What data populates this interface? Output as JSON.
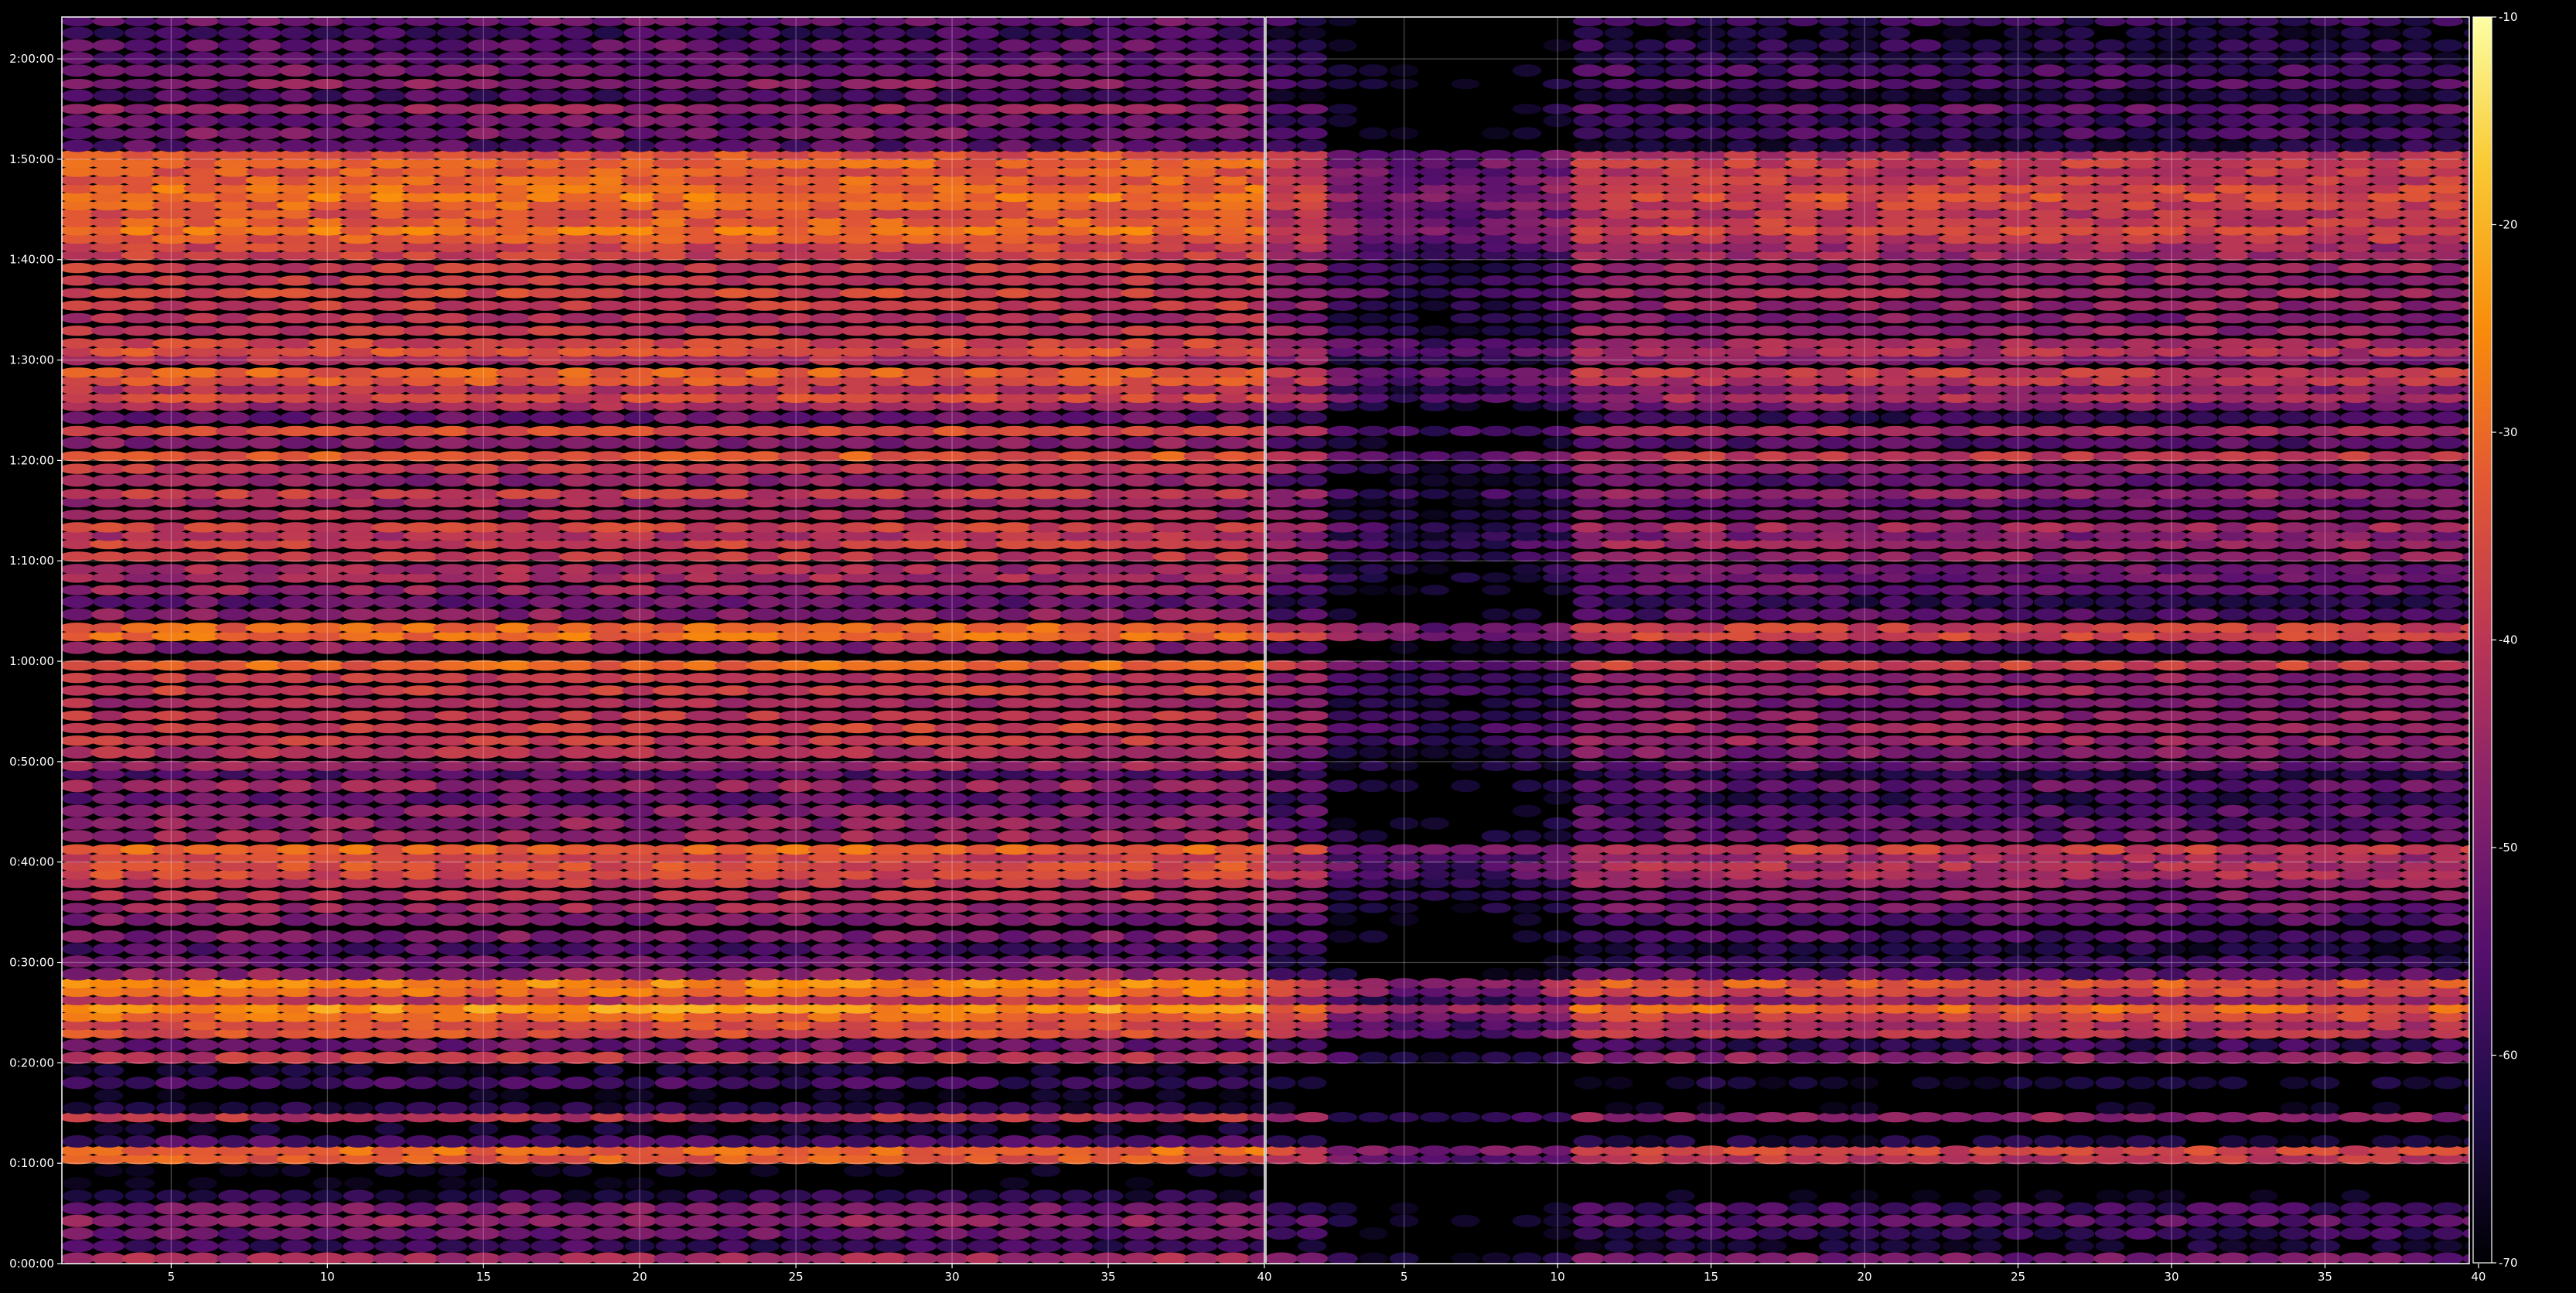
{
  "chart_data": {
    "type": "heatmap",
    "colormap": "inferno",
    "background_color": "#000000",
    "axis_color": "#ffffff",
    "grid": true,
    "panels": [
      {
        "name": "left",
        "xlim": [
          1.5,
          40
        ],
        "ylim": [
          0,
          7450
        ],
        "x_ticks": [
          5,
          10,
          15,
          20,
          25,
          30,
          35,
          40
        ],
        "x_tick_labels": [
          "5",
          "10",
          "15",
          "20",
          "25",
          "30",
          "35",
          "40"
        ],
        "y_ticks": [
          0,
          600,
          1200,
          1800,
          2400,
          3000,
          3600,
          4200,
          4800,
          5400,
          6000,
          6600,
          7200
        ],
        "y_tick_labels": [
          "0:00:00",
          "0:10:00",
          "0:20:00",
          "0:30:00",
          "0:40:00",
          "0:50:00",
          "1:00:00",
          "1:10:00",
          "1:20:00",
          "1:30:00",
          "1:40:00",
          "1:50:00",
          "2:00:00"
        ]
      },
      {
        "name": "right",
        "xlim": [
          0.5,
          39.7
        ],
        "ylim": [
          0,
          7450
        ],
        "x_ticks": [
          5,
          10,
          15,
          20,
          25,
          30,
          35,
          40
        ],
        "x_tick_labels": [
          "5",
          "10",
          "15",
          "20",
          "25",
          "30",
          "35",
          "40"
        ]
      }
    ],
    "colorbar": {
      "range": [
        -70,
        -10
      ],
      "ticks": [
        -70,
        -60,
        -50,
        -40,
        -30,
        -20,
        -10
      ],
      "tick_labels": [
        "-70",
        "-60",
        "-50",
        "-40",
        "-30",
        "-20",
        "-10"
      ]
    },
    "row_levels": [
      [
        0,
        60,
        -44
      ],
      [
        75,
        60,
        -58
      ],
      [
        150,
        60,
        -52
      ],
      [
        225,
        60,
        -47
      ],
      [
        300,
        60,
        -50
      ],
      [
        375,
        60,
        -62
      ],
      [
        450,
        60,
        -70
      ],
      [
        525,
        60,
        -68
      ],
      [
        600,
        50,
        -33
      ],
      [
        650,
        50,
        -30
      ],
      [
        700,
        60,
        -57
      ],
      [
        775,
        60,
        -66
      ],
      [
        850,
        50,
        -40
      ],
      [
        900,
        60,
        -62
      ],
      [
        975,
        60,
        -69
      ],
      [
        1050,
        60,
        -58
      ],
      [
        1125,
        60,
        -66
      ],
      [
        1200,
        60,
        -40
      ],
      [
        1275,
        60,
        -52
      ],
      [
        1350,
        50,
        -34
      ],
      [
        1400,
        50,
        -35
      ],
      [
        1450,
        50,
        -30
      ],
      [
        1500,
        50,
        -24
      ],
      [
        1550,
        50,
        -40
      ],
      [
        1600,
        50,
        -29
      ],
      [
        1650,
        50,
        -26
      ],
      [
        1700,
        60,
        -47
      ],
      [
        1775,
        60,
        -52
      ],
      [
        1850,
        60,
        -56
      ],
      [
        1925,
        60,
        -49
      ],
      [
        2025,
        60,
        -49
      ],
      [
        2100,
        50,
        -44
      ],
      [
        2175,
        50,
        -42
      ],
      [
        2250,
        50,
        -40
      ],
      [
        2300,
        50,
        -36
      ],
      [
        2350,
        50,
        -35
      ],
      [
        2400,
        50,
        -37
      ],
      [
        2450,
        50,
        -31
      ],
      [
        2525,
        60,
        -45
      ],
      [
        2600,
        60,
        -47
      ],
      [
        2675,
        60,
        -48
      ],
      [
        2750,
        60,
        -53
      ],
      [
        2825,
        60,
        -46
      ],
      [
        2900,
        50,
        -55
      ],
      [
        2950,
        50,
        -45
      ],
      [
        3025,
        60,
        -42
      ],
      [
        3100,
        50,
        -39
      ],
      [
        3175,
        50,
        -38
      ],
      [
        3250,
        50,
        -40
      ],
      [
        3325,
        50,
        -43
      ],
      [
        3400,
        50,
        -38
      ],
      [
        3475,
        50,
        -40
      ],
      [
        3550,
        50,
        -31
      ],
      [
        3650,
        60,
        -48
      ],
      [
        3725,
        50,
        -30
      ],
      [
        3775,
        50,
        -31
      ],
      [
        3850,
        60,
        -48
      ],
      [
        3925,
        60,
        -53
      ],
      [
        4000,
        50,
        -46
      ],
      [
        4075,
        50,
        -44
      ],
      [
        4125,
        50,
        -44
      ],
      [
        4200,
        50,
        -40
      ],
      [
        4275,
        50,
        -38
      ],
      [
        4325,
        50,
        -42
      ],
      [
        4375,
        50,
        -38
      ],
      [
        4450,
        50,
        -43
      ],
      [
        4525,
        50,
        -45
      ],
      [
        4575,
        50,
        -39
      ],
      [
        4650,
        60,
        -47
      ],
      [
        4725,
        50,
        -40
      ],
      [
        4800,
        50,
        -33
      ],
      [
        4875,
        60,
        -48
      ],
      [
        4950,
        50,
        -36
      ],
      [
        5025,
        60,
        -52
      ],
      [
        5100,
        50,
        -44
      ],
      [
        5150,
        50,
        -36
      ],
      [
        5200,
        50,
        -41
      ],
      [
        5250,
        50,
        -34
      ],
      [
        5300,
        50,
        -32
      ],
      [
        5375,
        60,
        -42
      ],
      [
        5425,
        50,
        -35
      ],
      [
        5475,
        50,
        -37
      ],
      [
        5550,
        50,
        -40
      ],
      [
        5625,
        50,
        -42
      ],
      [
        5700,
        50,
        -39
      ],
      [
        5775,
        50,
        -37
      ],
      [
        5850,
        50,
        -40
      ],
      [
        5925,
        50,
        -39
      ],
      [
        6000,
        50,
        -38
      ],
      [
        6050,
        50,
        -37
      ],
      [
        6100,
        50,
        -33
      ],
      [
        6150,
        50,
        -29
      ],
      [
        6200,
        50,
        -32
      ],
      [
        6250,
        50,
        -34
      ],
      [
        6300,
        50,
        -31
      ],
      [
        6350,
        50,
        -28
      ],
      [
        6400,
        50,
        -30
      ],
      [
        6450,
        50,
        -32
      ],
      [
        6500,
        50,
        -33
      ],
      [
        6550,
        50,
        -31
      ],
      [
        6600,
        50,
        -34
      ],
      [
        6650,
        60,
        -55
      ],
      [
        6725,
        60,
        -50
      ],
      [
        6800,
        60,
        -52
      ],
      [
        6875,
        50,
        -46
      ],
      [
        6950,
        60,
        -56
      ],
      [
        7025,
        50,
        -48
      ],
      [
        7100,
        60,
        -50
      ],
      [
        7175,
        60,
        -55
      ],
      [
        7250,
        60,
        -53
      ],
      [
        7325,
        60,
        -58
      ],
      [
        7400,
        50,
        -52
      ]
    ]
  }
}
